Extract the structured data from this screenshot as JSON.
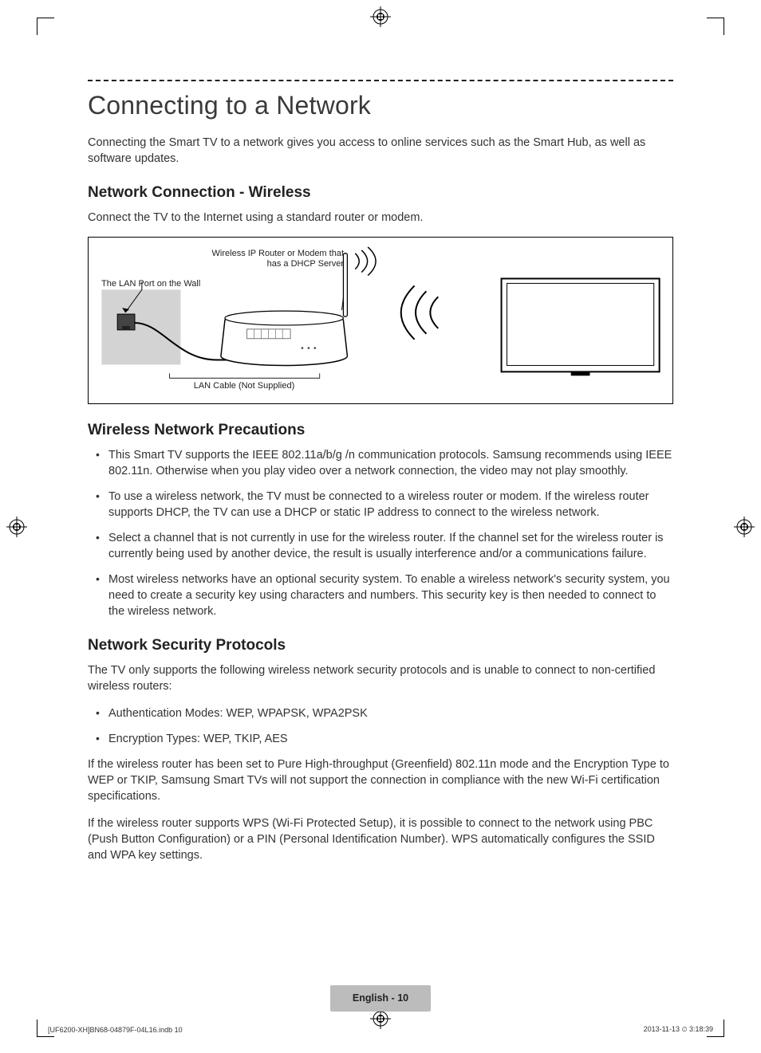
{
  "title": "Connecting to a Network",
  "intro": "Connecting the Smart TV to a network gives you access to online services such as the Smart Hub, as well as software updates.",
  "section1": {
    "heading": "Network Connection - Wireless",
    "body": "Connect the TV to the Internet using a standard router or modem."
  },
  "diagram": {
    "label_router": "Wireless IP Router or Modem that has a DHCP Server",
    "label_wall": "The LAN Port on the Wall",
    "label_cable": "LAN Cable (Not Supplied)"
  },
  "section2": {
    "heading": "Wireless Network Precautions",
    "bullets": [
      "This Smart TV supports the IEEE 802.11a/b/g /n communication protocols. Samsung recommends using IEEE 802.11n. Otherwise when you play video over a network connection, the video may not play smoothly.",
      "To use a wireless network, the TV must be connected to a wireless router or modem. If the wireless router supports DHCP, the TV can use a DHCP or static IP address to connect to the wireless network.",
      "Select a channel that is not currently in use for the wireless router. If the channel set for the wireless router is currently being used by another device, the result is usually interference and/or a communications failure.",
      "Most wireless networks have an optional security system. To enable a wireless network's security system, you need to create a security key using characters and numbers. This security key is then needed to connect to the wireless network."
    ]
  },
  "section3": {
    "heading": "Network Security Protocols",
    "body1": "The TV only supports the following wireless network security protocols and is unable to connect to non-certified wireless routers:",
    "bullets": [
      "Authentication Modes: WEP, WPAPSK, WPA2PSK",
      "Encryption Types: WEP, TKIP, AES"
    ],
    "body2": "If the wireless router has been set to Pure High-throughput (Greenfield) 802.11n mode and the Encryption Type to WEP or TKIP, Samsung Smart TVs will not support the connection in compliance with the new Wi-Fi certification specifications.",
    "body3": "If the wireless router supports WPS (Wi-Fi Protected Setup), it is possible to connect to the network using PBC (Push Button Configuration) or a PIN (Personal Identification Number). WPS automatically configures the SSID and WPA key settings."
  },
  "footer": {
    "language": "English",
    "page_number": "10",
    "print_left": "[UF6200-XH]BN68-04879F-04L16.indb   10",
    "print_right": "2013-11-13   ⏲ 3:18:39"
  }
}
